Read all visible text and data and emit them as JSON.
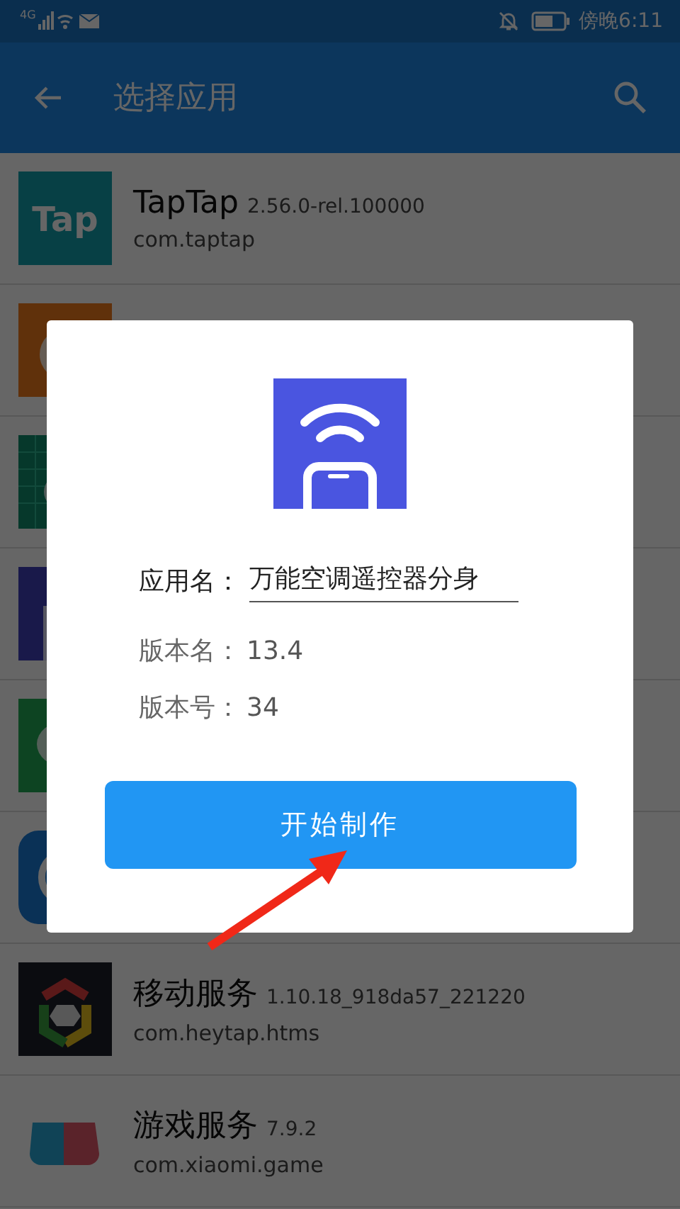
{
  "status_bar": {
    "network": "4G",
    "time": "傍晚6:11"
  },
  "app_bar": {
    "title": "选择应用"
  },
  "apps": [
    {
      "kind": "full",
      "icon_text": "Tap",
      "name": "TapTap",
      "version": "2.56.0-rel.100000",
      "package": "com.taptap"
    },
    {
      "kind": "covered"
    },
    {
      "kind": "covered"
    },
    {
      "kind": "covered"
    },
    {
      "kind": "covered"
    },
    {
      "kind": "covered"
    },
    {
      "kind": "full",
      "name": "移动服务",
      "version": "1.10.18_918da57_221220",
      "package": "com.heytap.htms"
    },
    {
      "kind": "full",
      "name": "游戏服务",
      "version": "7.9.2",
      "package": "com.xiaomi.game"
    }
  ],
  "dialog": {
    "fields": [
      {
        "kind": "input",
        "label": "应用名：",
        "value": "万能空调遥控器分身"
      },
      {
        "kind": "text",
        "label": "版本名：",
        "value": "13.4"
      },
      {
        "kind": "text",
        "label": "版本号：",
        "value": "34"
      }
    ],
    "button": "开始制作"
  }
}
